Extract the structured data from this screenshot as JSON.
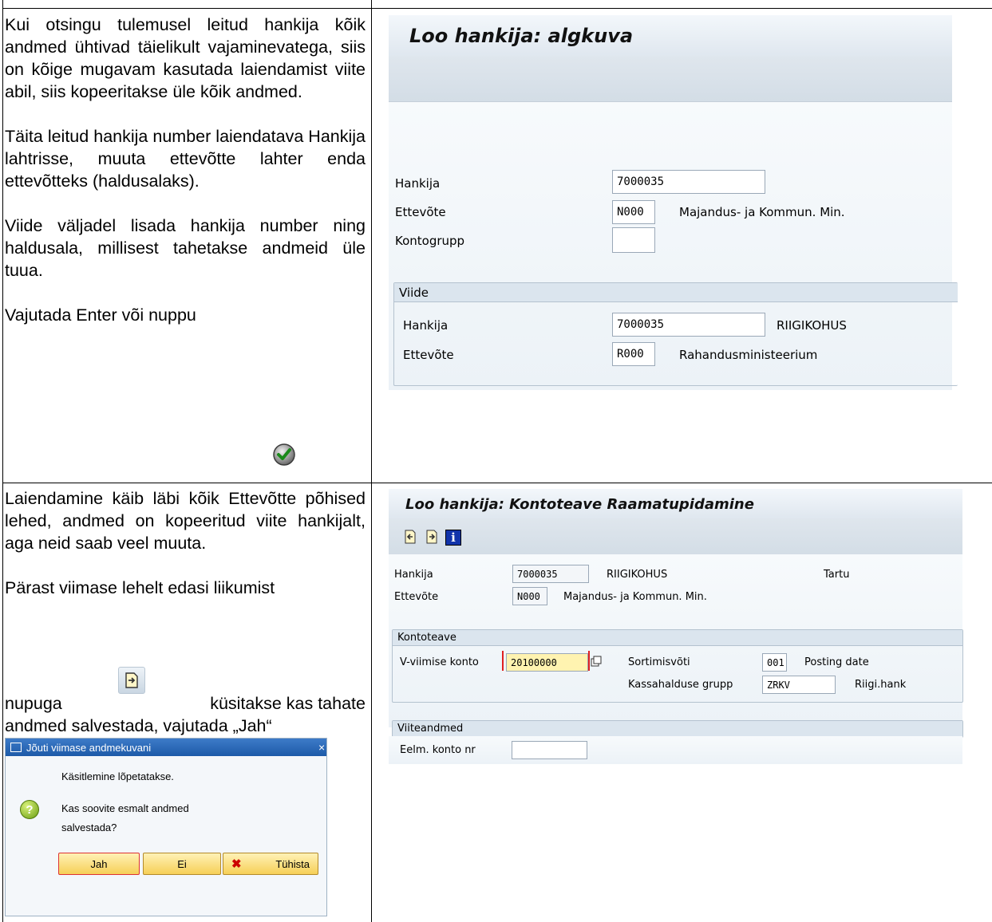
{
  "row1": {
    "text": {
      "para1": "Kui otsingu tulemusel leitud hankija kõik andmed ühtivad täielikult vajaminevatega, siis on kõige mugavam kasutada laiendamist viite abil, siis kopeeritakse üle kõik andmed.",
      "para2": "Täita leitud hankija number laiendatava Hankija lahtrisse, muuta ettevõtte lahter enda ettevõtteks (haldusalaks).",
      "para3": "Viide väljadel lisada hankija number ning haldusala, millisest tahetakse andmeid üle tuua.",
      "para4": "Vajutada Enter või nuppu"
    },
    "screen": {
      "title": "Loo hankija:  algkuva",
      "fields": {
        "hankija_label": "Hankija",
        "hankija_value": "7000035",
        "ettevote_label": "Ettevõte",
        "ettevote_value": "N000",
        "ettevote_desc": "Majandus- ja Kommun. Min.",
        "kontogrupp_label": "Kontogrupp",
        "kontogrupp_value": ""
      },
      "viide": {
        "header": "Viide",
        "hankija_label": "Hankija",
        "hankija_value": "7000035",
        "hankija_desc": "RIIGIKOHUS",
        "ettevote_label": "Ettevõte",
        "ettevote_value": "R000",
        "ettevote_desc": "Rahandusministeerium"
      }
    },
    "enter_icon": "check-icon"
  },
  "row2": {
    "text": {
      "para1": "Laiendamine käib läbi kõik Ettevõtte põhised lehed, andmed on kopeeritud viite hankijalt, aga neid saab veel muuta.",
      "para2_a": "Pärast viimase lehelt edasi liikumist",
      "para2_b_pre": "nupuga",
      "para2_b_post": "küsitakse kas tahate",
      "para2_c": "andmed salvestada, vajutada „Jah“"
    },
    "screen": {
      "title": "Loo hankija: Kontoteave Raamatupidamine",
      "toolbar_icons": [
        "prev-screen-icon",
        "next-screen-icon",
        "info-icon"
      ],
      "hankija_label": "Hankija",
      "hankija_value": "7000035",
      "hankija_name": "RIIGIKOHUS",
      "hankija_city": "Tartu",
      "ettevote_label": "Ettevõte",
      "ettevote_value": "N000",
      "ettevote_desc": "Majandus- ja Kommun. Min.",
      "kontoteave": {
        "header": "Kontoteave",
        "v_konto_label": "V-viimise konto",
        "v_konto_value": "20100000",
        "sort_label": "Sortimisvõti",
        "sort_value": "001",
        "sort_desc": "Posting date",
        "kassa_label": "Kassahalduse grupp",
        "kassa_value": "ZRKV",
        "kassa_desc": "Riigi.hank"
      },
      "viiteandmed": {
        "header": "Viiteandmed",
        "eelm_label": "Eelm. konto nr",
        "eelm_value": ""
      }
    },
    "dialog": {
      "title": "Jõuti viimase andmekuvani",
      "line1": "Käsitlemine lõpetatakse.",
      "question1": "Kas soovite esmalt andmed",
      "question2": "salvestada?",
      "btn_yes": "Jah",
      "btn_no": "Ei",
      "btn_cancel": "Tühista"
    }
  }
}
